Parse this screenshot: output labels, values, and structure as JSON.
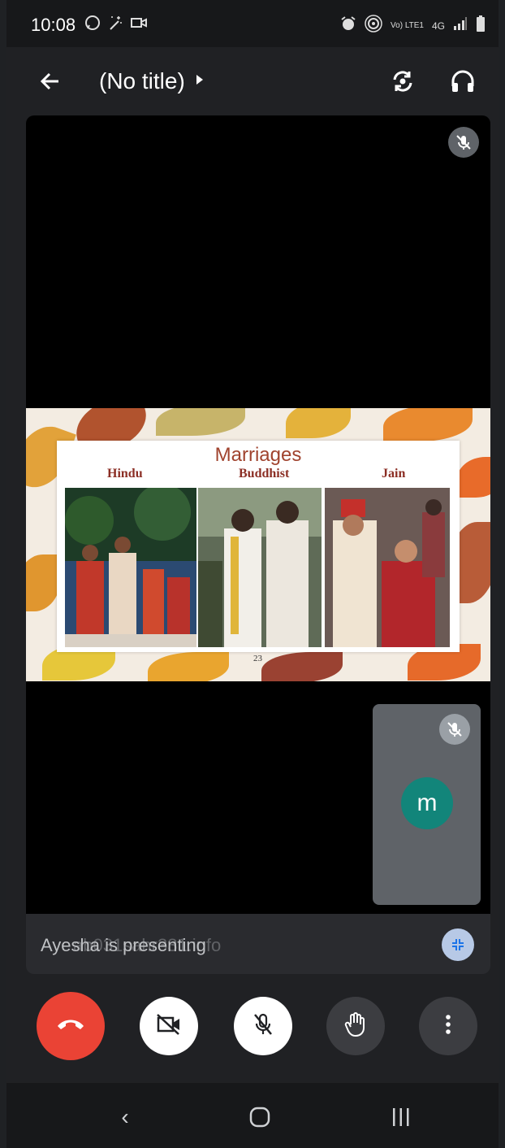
{
  "status_bar": {
    "time": "10:08",
    "network_label": "Vo) LTE1",
    "network_type": "4G",
    "left_icons": [
      "whatsapp-icon",
      "magic-wand-icon",
      "video-camera-icon"
    ],
    "right_icons": [
      "alarm-icon",
      "hotspot-icon",
      "signal-icon",
      "battery-icon"
    ]
  },
  "app_bar": {
    "title": "(No title)",
    "back_icon": "arrow-left-icon",
    "caret_icon": "caret-right-icon",
    "switch_camera_icon": "switch-camera-icon",
    "audio_icon": "headphones-icon"
  },
  "slide": {
    "title": "Marriages",
    "labels": [
      "Hindu",
      "Buddhist",
      "Jain"
    ],
    "page_number": "23"
  },
  "self_tile": {
    "avatar_initial": "m",
    "avatar_color": "#12857a"
  },
  "presenting_bar": {
    "text": "Ayesha is presenting",
    "ghost_text": "ab031sahr331.info"
  },
  "controls": {
    "end_call_color": "#ea4335",
    "buttons": [
      "end-call-icon",
      "camera-off-icon",
      "mic-off-icon",
      "raise-hand-icon",
      "more-vert-icon"
    ]
  },
  "nav_bar": {
    "back": "‹",
    "home": "○",
    "recents": "|||"
  }
}
